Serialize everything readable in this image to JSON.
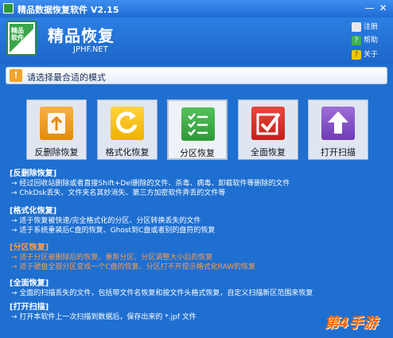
{
  "window": {
    "title": "精品数据恢复软件 V2.15",
    "minimize_glyph": "—",
    "close_glyph": "✕"
  },
  "header": {
    "logo_text": "精品软件",
    "title": "精品恢复",
    "subtitle": "JPHF.NET",
    "links": [
      {
        "label": "注册",
        "icon": "register-icon"
      },
      {
        "label": "帮助",
        "icon": "help-icon",
        "glyph": "?"
      },
      {
        "label": "关于",
        "icon": "about-icon",
        "glyph": "?"
      }
    ]
  },
  "prompt": {
    "icon_glyph": "!",
    "text": "请选择最合适的模式"
  },
  "modes": [
    {
      "label": "反删除恢复",
      "icon": "recycle-icon"
    },
    {
      "label": "格式化恢复",
      "icon": "refresh-icon"
    },
    {
      "label": "分区恢复",
      "icon": "checklist-icon",
      "selected": true
    },
    {
      "label": "全面恢复",
      "icon": "checkmark-icon"
    },
    {
      "label": "打开扫描",
      "icon": "arrow-up-icon"
    }
  ],
  "descriptions": [
    {
      "heading": "[反删除恢复]",
      "lines": [
        "→ 经过回收站删除或者直接Shift+Del删除的文件、杀毒、病毒、卸载软件等删除的文件",
        "→ ChkDsk丢失、文件夹名其妙消失、第三方加密软件弄丢的文件等"
      ]
    },
    {
      "heading": "[格式化恢复]",
      "lines": [
        "→ 适于恢复被快速/完全格式化的分区、分区转换丢失的文件",
        "→ 适于系统重装后C盘的恢复、Ghost到C盘或者别的盘符的恢复"
      ]
    },
    {
      "heading": "[分区恢复]",
      "lines": [
        "→ 适于分区被删除后的恢复、重新分区、分区调整大小后的恢复",
        "→ 适于硬盘全部分区变成一个C盘的恢复、分区打不开提示格式化RAW的恢复"
      ]
    },
    {
      "heading": "[全面恢复]",
      "lines": [
        "→ 全面的扫描丢失的文件，包括带文件名恢复和按文件头格式恢复，自定义扫描新区范围来恢复"
      ]
    },
    {
      "heading": "[打开扫描]",
      "lines": [
        "→ 打开本软件上一次扫描到数据后，保存出来的 *.jpf 文件"
      ]
    }
  ],
  "watermark": "第4手游",
  "colors": {
    "background": "#1e6fd0",
    "selected_desc": "#ff9d4a"
  }
}
